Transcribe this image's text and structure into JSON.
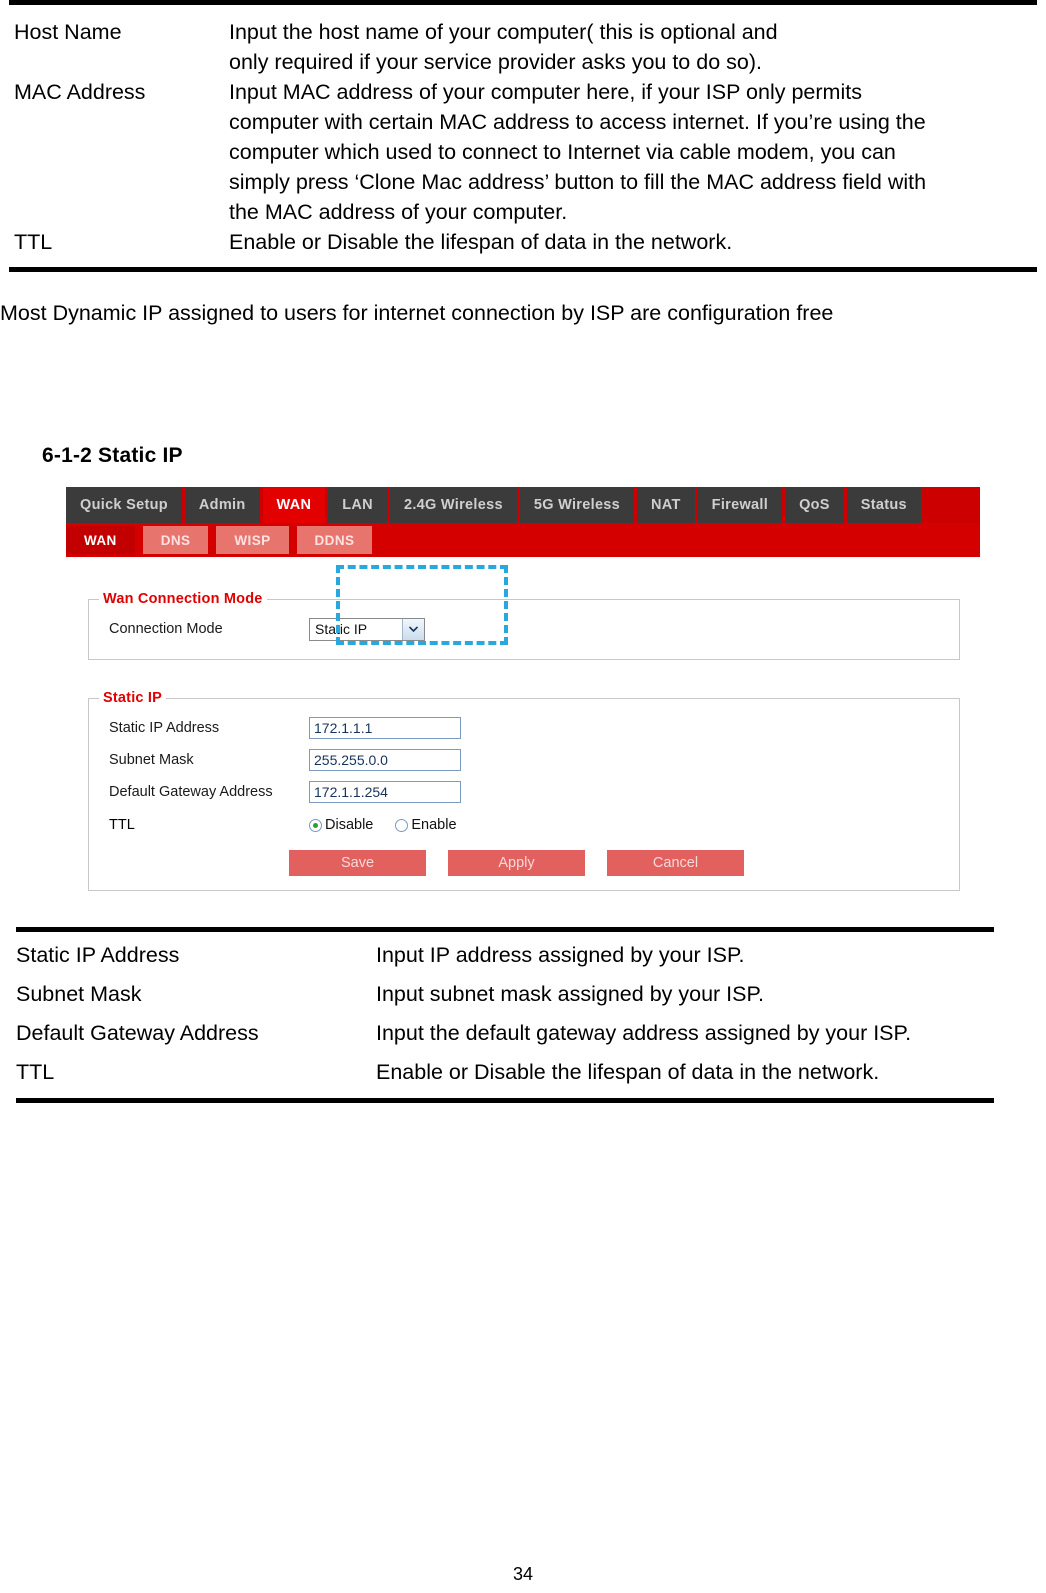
{
  "top_table": {
    "rows": [
      {
        "term": "Host Name",
        "desc_lines": [
          "Input the host name of your computer( this is optional and",
          "only required if your service provider asks you to do so)."
        ]
      },
      {
        "term": "MAC Address",
        "desc_lines": [
          "Input MAC address of your computer here, if your ISP only permits",
          "computer with certain MAC address to access internet. If you’re using the",
          "computer which used to connect to Internet via cable modem, you can",
          "simply press ‘Clone Mac address’ button to fill the MAC address field with",
          "the MAC address of your computer."
        ]
      },
      {
        "term": "TTL",
        "desc_lines": [
          "Enable or Disable the lifespan of data in the network."
        ]
      }
    ]
  },
  "paragraph": "Most Dynamic IP assigned to users for internet connection by ISP are configuration free",
  "section": {
    "heading": "6-1-2 Static IP"
  },
  "router_ui": {
    "main_tabs": [
      {
        "label": "Quick Setup",
        "active": false
      },
      {
        "label": "Admin",
        "active": false
      },
      {
        "label": "WAN",
        "active": true
      },
      {
        "label": "LAN",
        "active": false
      },
      {
        "label": "2.4G Wireless",
        "active": false
      },
      {
        "label": "5G Wireless",
        "active": false
      },
      {
        "label": "NAT",
        "active": false
      },
      {
        "label": "Firewall",
        "active": false
      },
      {
        "label": "QoS",
        "active": false
      },
      {
        "label": "Status",
        "active": false
      }
    ],
    "sub_tabs": [
      {
        "label": "WAN",
        "active": true
      },
      {
        "label": "DNS",
        "active": false
      },
      {
        "label": "WISP",
        "active": false
      },
      {
        "label": "DDNS",
        "active": false
      }
    ],
    "wan_connection_mode": {
      "legend": "Wan Connection Mode",
      "field_label": "Connection Mode",
      "selected_value": "Static IP",
      "arrow_glyph": "❯"
    },
    "static_ip": {
      "legend": "Static IP",
      "fields": [
        {
          "label": "Static IP Address",
          "value": "172.1.1.1"
        },
        {
          "label": "Subnet Mask",
          "value": "255.255.0.0"
        },
        {
          "label": "Default Gateway Address",
          "value": "172.1.1.254"
        }
      ],
      "ttl": {
        "label": "TTL",
        "options": [
          {
            "label": "Disable",
            "checked": true
          },
          {
            "label": "Enable",
            "checked": false
          }
        ]
      },
      "buttons": [
        {
          "label": "Save"
        },
        {
          "label": "Apply"
        },
        {
          "label": "Cancel"
        }
      ]
    },
    "colors": {
      "tab_bar_red": "#cc0000",
      "active_tab_red": "#e30000",
      "tab_dark": "#3b3b3b",
      "legend_red": "#e00000",
      "button_red": "#e2615e",
      "highlight_cyan": "#29a8e0"
    }
  },
  "bottom_table": {
    "rows": [
      {
        "term": "Static IP Address",
        "desc": "Input IP address assigned by your ISP."
      },
      {
        "term": "Subnet Mask",
        "desc": "Input subnet mask assigned by your ISP."
      },
      {
        "term": "Default Gateway Address",
        "desc": "Input the default gateway address assigned by your ISP."
      },
      {
        "term": "TTL",
        "desc": "Enable or Disable the lifespan of data in the network."
      }
    ]
  },
  "page_number": "34"
}
